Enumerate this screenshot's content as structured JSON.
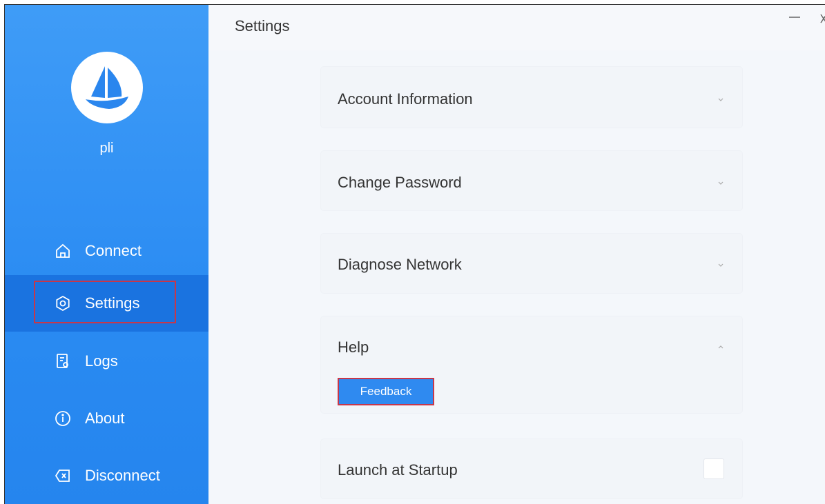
{
  "user": {
    "name": "pli"
  },
  "nav": {
    "items": [
      {
        "label": "Connect",
        "icon": "home-icon"
      },
      {
        "label": "Settings",
        "icon": "gear-icon",
        "active": true
      },
      {
        "label": "Logs",
        "icon": "log-icon"
      },
      {
        "label": "About",
        "icon": "info-icon"
      },
      {
        "label": "Disconnect",
        "icon": "disconnect-icon"
      }
    ]
  },
  "header": {
    "title": "Settings"
  },
  "settings": {
    "account": {
      "title": "Account Information"
    },
    "password": {
      "title": "Change Password"
    },
    "network": {
      "title": "Diagnose Network"
    },
    "help": {
      "title": "Help",
      "feedback_label": "Feedback"
    },
    "startup": {
      "title": "Launch at Startup",
      "checked": false
    }
  },
  "colors": {
    "sidebar": "#2a8bf2",
    "active": "#1a73e0",
    "highlight": "#c7374a",
    "button": "#2f8af0"
  }
}
